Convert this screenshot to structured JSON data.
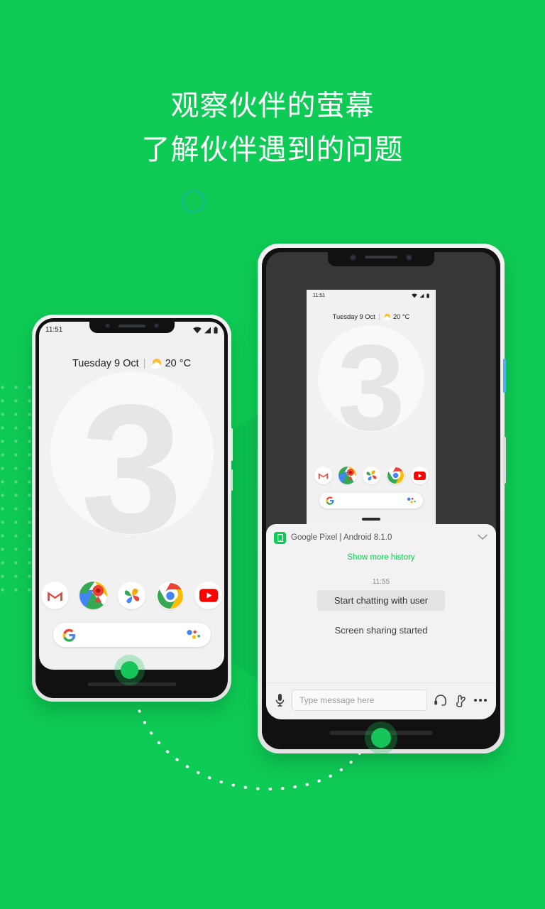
{
  "theme": {
    "background": "#0ECB55",
    "accent_ring": "#13C08A",
    "link_green": "#0ECB55",
    "touch_dot": "#16C65A"
  },
  "headline": {
    "line1": "观察伙伴的萤幕",
    "line2": "了解伙伴遇到的问题"
  },
  "phone_left": {
    "status": {
      "time": "11:51",
      "wifi": "wifi-icon",
      "signal": "signal-icon",
      "battery": "battery-icon"
    },
    "date_weather": {
      "date": "Tuesday 9 Oct",
      "separator": "|",
      "weather_icon": "sun-cloud-icon",
      "temperature": "20 °C"
    },
    "wallpaper_digit": "3",
    "dock": [
      {
        "name": "gmail-app-icon",
        "label": "Gmail"
      },
      {
        "name": "maps-app-icon",
        "label": "Maps"
      },
      {
        "name": "photos-app-icon",
        "label": "Photos"
      },
      {
        "name": "chrome-app-icon",
        "label": "Chrome"
      },
      {
        "name": "youtube-app-icon",
        "label": "YouTube"
      }
    ],
    "search": {
      "logo": "google-g-icon",
      "assistant": "assistant-icon"
    }
  },
  "phone_right": {
    "mirror": {
      "status": {
        "time": "11:51",
        "wifi": "wifi-icon",
        "signal": "signal-icon",
        "battery": "battery-icon"
      },
      "date_weather": {
        "date": "Tuesday 9 Oct",
        "separator": "|",
        "weather_icon": "sun-cloud-icon",
        "temperature": "20 °C"
      },
      "wallpaper_digit": "3",
      "dock": [
        {
          "name": "gmail-app-icon",
          "label": "Gmail"
        },
        {
          "name": "maps-app-icon",
          "label": "Maps"
        },
        {
          "name": "photos-app-icon",
          "label": "Photos"
        },
        {
          "name": "chrome-app-icon",
          "label": "Chrome"
        },
        {
          "name": "youtube-app-icon",
          "label": "YouTube"
        }
      ],
      "search": {
        "logo": "google-g-icon",
        "assistant": "assistant-icon"
      }
    },
    "chat": {
      "device_icon": "device-phone-icon",
      "device_name": "Google Pixel | Android 8.1.0",
      "collapse_icon": "chevron-down-icon",
      "show_more": "Show more history",
      "message_time": "11:55",
      "bubble_text": "Start chatting with user",
      "system_text": "Screen sharing started",
      "input": {
        "mic_icon": "microphone-icon",
        "placeholder": "Type message here",
        "value": "",
        "headset_icon": "headset-icon",
        "gesture_icon": "hand-gesture-icon",
        "more_icon": "more-options-icon"
      }
    }
  }
}
